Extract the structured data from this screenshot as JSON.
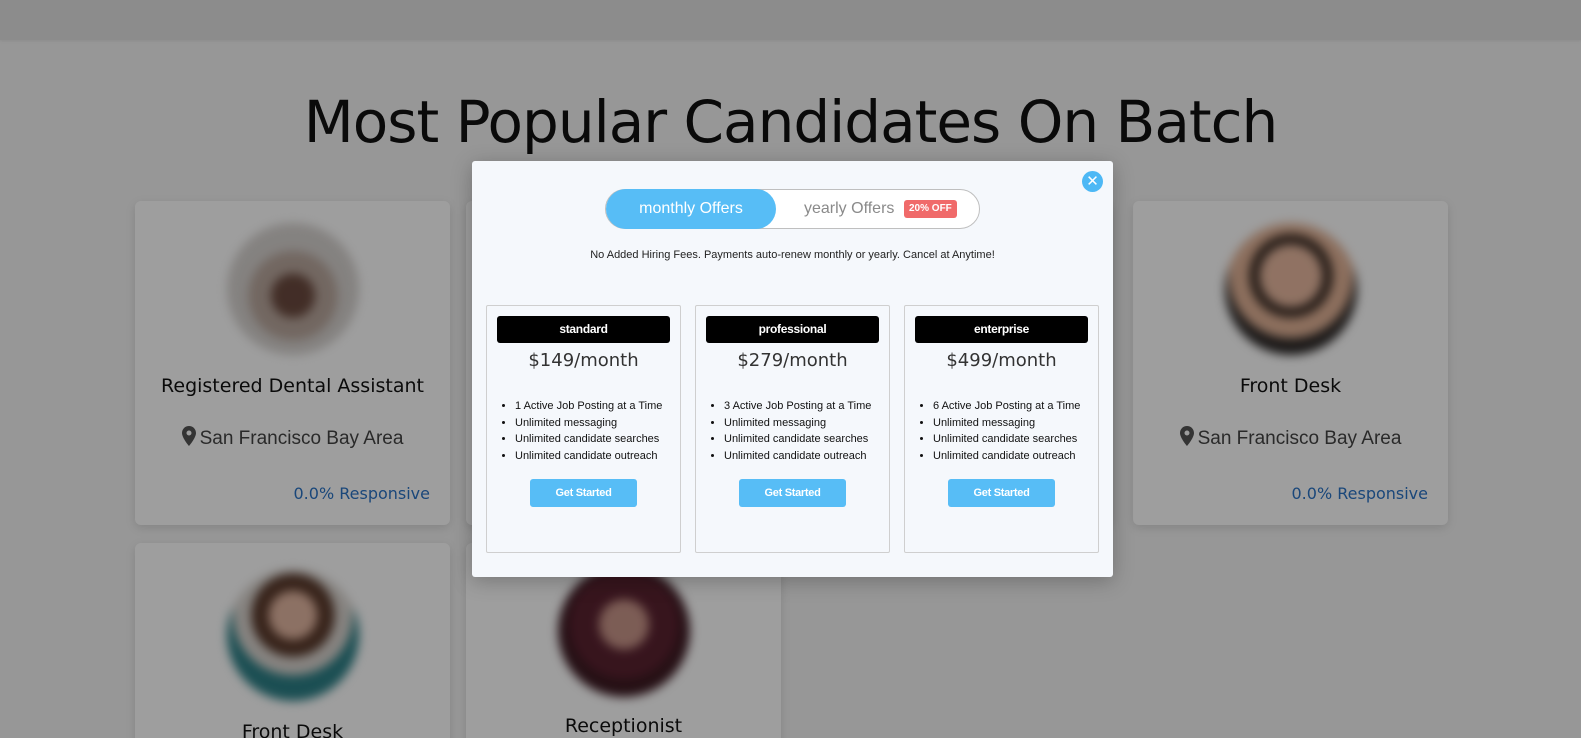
{
  "page": {
    "heading": "Most Popular Candidates On Batch"
  },
  "cards": [
    {
      "role": "Registered Dental Assistant",
      "location": "San Francisco Bay Area",
      "responsive": "0.0% Responsive"
    },
    {
      "role": "Front Desk",
      "location": "San Francisco Bay Area",
      "responsive": "0.0% Responsive"
    },
    {
      "role": "Front Desk"
    },
    {
      "role": "Receptionist"
    }
  ],
  "modal": {
    "toggle": {
      "monthly_label": "monthly Offers",
      "yearly_label": "yearly Offers",
      "discount_badge": "20% OFF",
      "selected": "monthly"
    },
    "notice": "No Added Hiring Fees. Payments auto-renew monthly or yearly. Cancel at Anytime!",
    "plans": [
      {
        "name": "standard",
        "price": "$149/month",
        "features": [
          "1 Active Job Posting at a Time",
          "Unlimited messaging",
          "Unlimited candidate searches",
          "Unlimited candidate outreach"
        ],
        "cta": "Get Started"
      },
      {
        "name": "professional",
        "price": "$279/month",
        "features": [
          "3 Active Job Posting at a Time",
          "Unlimited messaging",
          "Unlimited candidate searches",
          "Unlimited candidate outreach"
        ],
        "cta": "Get Started"
      },
      {
        "name": "enterprise",
        "price": "$499/month",
        "features": [
          "6 Active Job Posting at a Time",
          "Unlimited messaging",
          "Unlimited candidate searches",
          "Unlimited candidate outreach"
        ],
        "cta": "Get Started"
      }
    ],
    "close_icon": "close-icon"
  },
  "colors": {
    "accent": "#57bdf6",
    "discount": "#f06a6a",
    "responsive_link": "#2a73c6"
  }
}
